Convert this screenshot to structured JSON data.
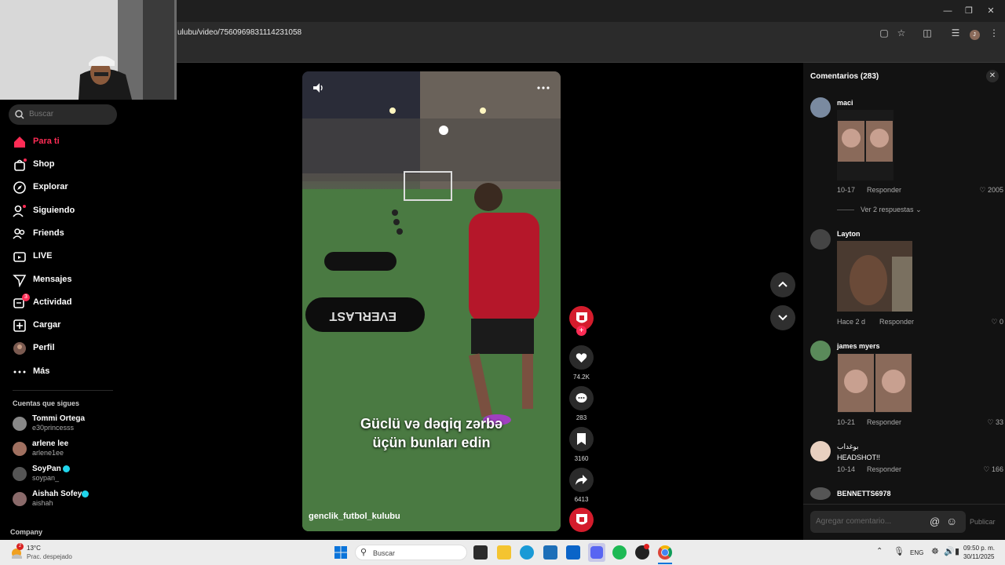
{
  "browser": {
    "url": "ulubu/video/7560969831114231058"
  },
  "sidebar": {
    "search_placeholder": "Buscar",
    "nav": [
      {
        "label": "Para ti",
        "icon": "home-icon",
        "active": true
      },
      {
        "label": "Shop",
        "icon": "shop-bag-icon"
      },
      {
        "label": "Explorar",
        "icon": "compass-icon"
      },
      {
        "label": "Siguiendo",
        "icon": "following-icon"
      },
      {
        "label": "Friends",
        "icon": "friends-icon"
      },
      {
        "label": "LIVE",
        "icon": "live-tv-icon"
      },
      {
        "label": "Mensajes",
        "icon": "paper-plane-icon"
      },
      {
        "label": "Actividad",
        "icon": "activity-icon",
        "badge": "3"
      },
      {
        "label": "Cargar",
        "icon": "upload-plus-icon"
      },
      {
        "label": "Perfil",
        "icon": "profile-avatar-icon"
      },
      {
        "label": "Más",
        "icon": "more-dots-icon"
      }
    ],
    "following_title": "Cuentas que sigues",
    "following": [
      {
        "name": "Tommi Ortega",
        "handle": "e30princesss"
      },
      {
        "name": "arlene lee",
        "handle": "arlene1ee"
      },
      {
        "name": "SoyPan",
        "handle": "soypan_",
        "verified": true
      },
      {
        "name": "Aishah Sofey",
        "handle": "aishah",
        "verified": true
      }
    ],
    "company_label": "Company"
  },
  "video": {
    "caption_line1": "Güclü və dəqiq zərbə",
    "caption_line2": "üçün bunları edin",
    "author": "genclik_futbol_kulubu",
    "bag_text": "EVERLAST"
  },
  "actions": {
    "likes": "74.2K",
    "comments": "283",
    "saves": "3160",
    "shares": "6413"
  },
  "comments": {
    "title": "Comentarios (283)",
    "reply_label": "Responder",
    "view_replies": "Ver 2 respuestas",
    "input_placeholder": "Agregar comentario...",
    "publish_label": "Publicar",
    "items": [
      {
        "user": "maci",
        "date": "10-17",
        "likes": "2005"
      },
      {
        "user": "Layton",
        "date": "Hace 2 d",
        "likes": "0"
      },
      {
        "user": "james myers",
        "date": "10-21",
        "likes": "33"
      },
      {
        "user": "بوغداب",
        "text": "HEADSHOT!!",
        "date": "10-14",
        "likes": "166"
      },
      {
        "user": "BENNETTS6978"
      }
    ]
  },
  "taskbar": {
    "weather_temp": "13°C",
    "weather_desc": "Prac. despejado",
    "weather_badge": "2",
    "search_label": "Buscar",
    "lang": "ENG",
    "time": "09:50 p. m.",
    "date": "30/11/2025"
  },
  "colors": {
    "accent": "#fe2c55",
    "bg": "#000000",
    "panel": "#121212"
  }
}
